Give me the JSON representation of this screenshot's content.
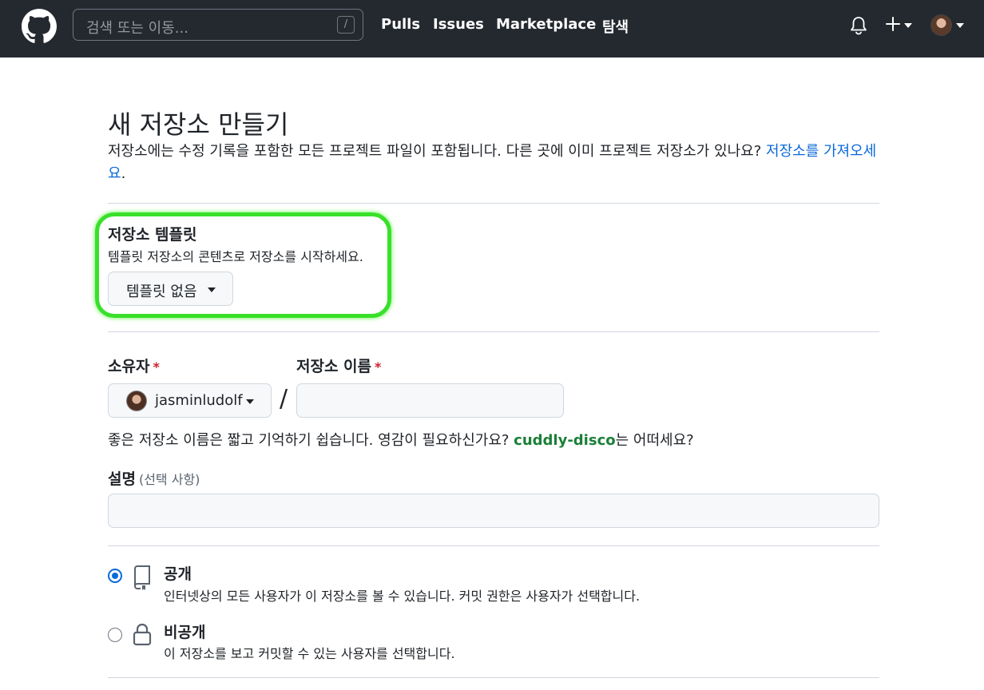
{
  "header": {
    "search_placeholder": "검색 또는 이동...",
    "search_shortcut": "/",
    "nav": [
      "Pulls",
      "Issues",
      "Marketplace",
      "탐색"
    ]
  },
  "page": {
    "title": "새 저장소 만들기",
    "description": "저장소에는 수정 기록을 포함한 모든 프로젝트 파일이 포함됩니다. 다른 곳에 이미 프로젝트 저장소가 있나요? ",
    "import_link": "저장소를 가져오세요",
    "description_end": "."
  },
  "template": {
    "title": "저장소 템플릿",
    "description": "템플릿 저장소의 콘텐츠로 저장소를 시작하세요.",
    "button_label": "템플릿 없음"
  },
  "owner": {
    "label": "소유자",
    "required_mark": "*",
    "value": "jasminludolf"
  },
  "repo_name": {
    "label": "저장소 이름",
    "required_mark": "*",
    "value": ""
  },
  "name_hint": {
    "before": "좋은 저장소 이름은 짧고 기억하기 쉽습니다. 영감이 필요하신가요? ",
    "suggestion": "cuddly-disco",
    "after": "는 어떠세요?"
  },
  "description_field": {
    "label": "설명",
    "optional": "(선택 사항)",
    "value": ""
  },
  "visibility": {
    "selected": "public",
    "public": {
      "title": "공개",
      "description": "인터넷상의 모든 사용자가 이 저장소를 볼 수 있습니다. 커밋 권한은 사용자가 선택합니다."
    },
    "private": {
      "title": "비공개",
      "description": "이 저장소를 보고 커밋할 수 있는 사용자를 선택합니다."
    }
  },
  "colors": {
    "header_bg": "#24292f",
    "link": "#0969da",
    "suggestion": "#1a7f37",
    "highlight": "#39e02a",
    "required": "#cf222e"
  }
}
